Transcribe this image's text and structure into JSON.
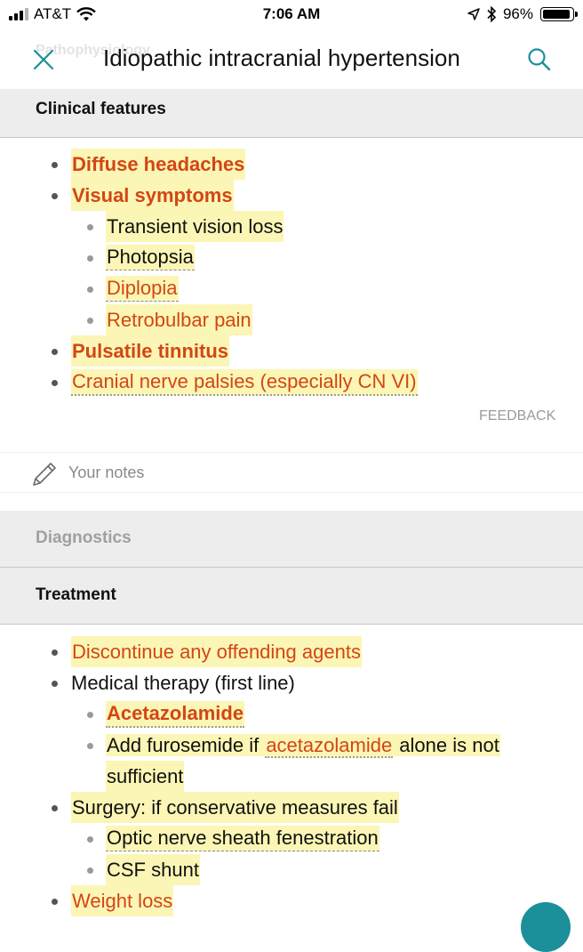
{
  "status_bar": {
    "carrier": "AT&T",
    "time": "7:06 AM",
    "battery": "96%"
  },
  "header": {
    "back_title": "Pathophysiology",
    "title": "Idiopathic intracranial hypertension"
  },
  "clinical": {
    "label": "Clinical features",
    "items": {
      "headaches": "Diffuse headaches",
      "visual": "Visual symptoms",
      "vis_loss": "Transient vision loss",
      "photopsia": "Photopsia",
      "diplopia": "Diplopia",
      "retro": "Retrobulbar pain",
      "tinnitus": "Pulsatile tinnitus",
      "cranial": "Cranial nerve palsies (especially CN VI)"
    },
    "feedback": "FEEDBACK"
  },
  "notes": {
    "label": "Your notes"
  },
  "diagnostics": {
    "label": "Diagnostics"
  },
  "treatment": {
    "label": "Treatment",
    "items": {
      "discontinue": "Discontinue any offending agents",
      "medical": "Medical therapy (first line)",
      "acetazolamide": "Acetazolamide",
      "add_pre": "Add furosemide if ",
      "add_link": "acetazolamide",
      "add_post": " alone is not",
      "add_cont": "sufficient",
      "surgery": "Surgery: if conservative measures fail",
      "optic": "Optic nerve sheath fenestration",
      "csf": "CSF shunt",
      "weight": "Weight loss"
    }
  }
}
